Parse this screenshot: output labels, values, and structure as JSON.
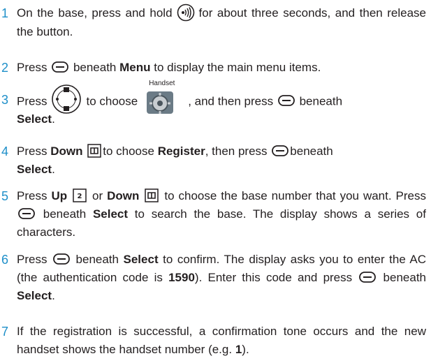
{
  "steps": [
    {
      "number": "1",
      "a": "On the base, press and hold",
      "b": "for about three seconds, and then release the button."
    },
    {
      "number": "2",
      "a": "Press",
      "b": "beneath",
      "c": "Menu",
      "d": "to display the main menu items."
    },
    {
      "number": "3",
      "a": "Press",
      "b": "to choose",
      "caption": "Handset",
      "c": ", and then press",
      "d": "beneath",
      "e": "Select",
      "f": "."
    },
    {
      "number": "4",
      "a": "Press",
      "b": "Down",
      "c": "to choose",
      "d": "Register",
      "e": ", then press",
      "f": "beneath",
      "g": "Select",
      "h": "."
    },
    {
      "number": "5",
      "a": "Press",
      "b": "Up",
      "c": "or",
      "d": "Down",
      "e": "to choose the base number that you want. Press",
      "f": "beneath",
      "g": "Select",
      "h": "to search the base. The display shows a series of characters."
    },
    {
      "number": "6",
      "a": "Press",
      "b": "beneath",
      "c": "Select",
      "d": "to confirm. The display asks you to enter the AC (the authentication code is",
      "e": "1590",
      "f": "). Enter this code and press",
      "g": "beneath",
      "h": "Select",
      "i": "."
    },
    {
      "number": "7",
      "a": "If the registration is successful, a confirmation tone occurs and the new handset shows the handset number (e.g.",
      "b": "1",
      "c": ")."
    }
  ],
  "icons": {
    "page_key": "page-icon",
    "base_button": "paging-waves-icon",
    "soft_key": "soft-key-icon",
    "nav_key": "navigation-key-icon",
    "handset_settings": "handset-gear-icon",
    "down_key": "down-phonebook-icon",
    "up_key": "up-contact-icon"
  },
  "colors": {
    "step_number": "#1e8fc9",
    "text": "#231f20"
  }
}
